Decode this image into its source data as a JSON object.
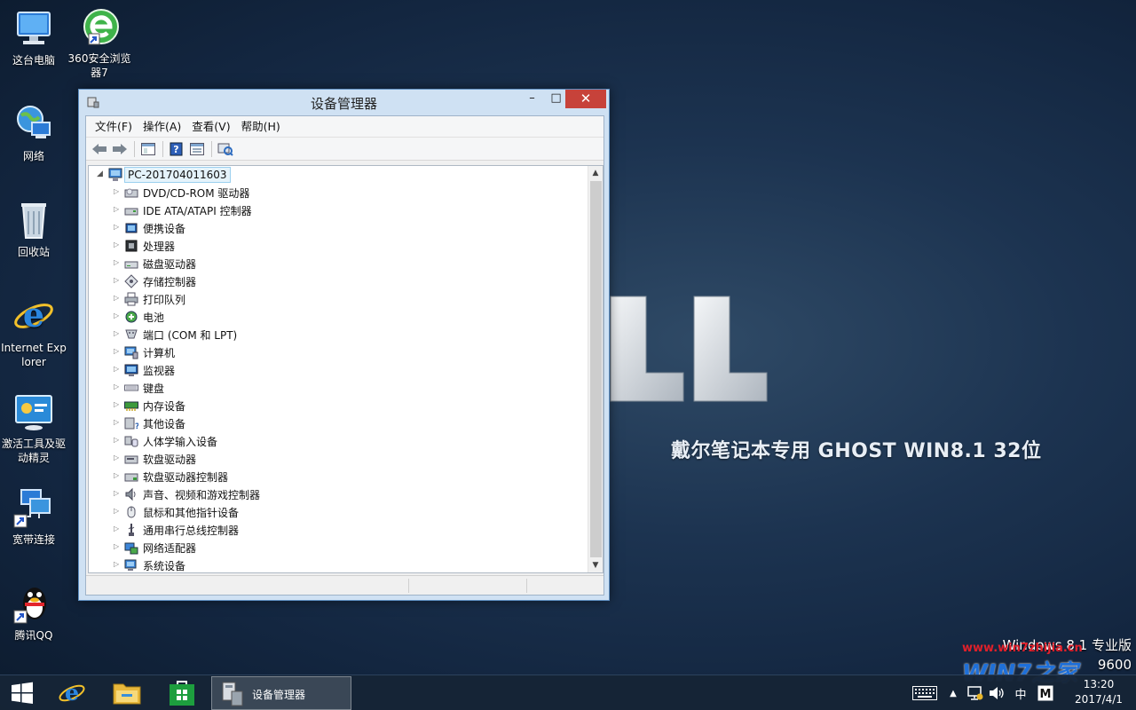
{
  "desktop": {
    "icons": [
      {
        "label": "这台电脑"
      },
      {
        "label": "360安全浏览器7"
      },
      {
        "label": "网络"
      },
      {
        "label": "回收站"
      },
      {
        "label": "Internet Explorer"
      },
      {
        "label": "激活工具及驱动精灵"
      },
      {
        "label": "宽带连接"
      },
      {
        "label": "腾讯QQ"
      }
    ],
    "wallpaper_text": "戴尔笔记本专用  GHOST WIN8.1 32位",
    "version_line1": "Windows 8.1 专业版",
    "version_line2": "9600",
    "watermark_url": "www.win7zhijia.cn",
    "watermark_logo": "WIN7之家"
  },
  "window": {
    "title": "设备管理器",
    "menu": [
      "文件(F)",
      "操作(A)",
      "查看(V)",
      "帮助(H)"
    ],
    "root": "PC-201704011603",
    "devices": [
      {
        "label": "DVD/CD-ROM 驱动器",
        "icon": "dvd-drive-icon"
      },
      {
        "label": "IDE ATA/ATAPI 控制器",
        "icon": "ide-controller-icon"
      },
      {
        "label": "便携设备",
        "icon": "portable-device-icon"
      },
      {
        "label": "处理器",
        "icon": "processor-icon"
      },
      {
        "label": "磁盘驱动器",
        "icon": "disk-drive-icon"
      },
      {
        "label": "存储控制器",
        "icon": "storage-controller-icon"
      },
      {
        "label": "打印队列",
        "icon": "printer-icon"
      },
      {
        "label": "电池",
        "icon": "battery-icon"
      },
      {
        "label": "端口 (COM 和 LPT)",
        "icon": "port-icon"
      },
      {
        "label": "计算机",
        "icon": "computer-icon"
      },
      {
        "label": "监视器",
        "icon": "monitor-icon"
      },
      {
        "label": "键盘",
        "icon": "keyboard-icon"
      },
      {
        "label": "内存设备",
        "icon": "memory-icon"
      },
      {
        "label": "其他设备",
        "icon": "other-device-icon"
      },
      {
        "label": "人体学输入设备",
        "icon": "hid-icon"
      },
      {
        "label": "软盘驱动器",
        "icon": "floppy-drive-icon"
      },
      {
        "label": "软盘驱动器控制器",
        "icon": "floppy-controller-icon"
      },
      {
        "label": "声音、视频和游戏控制器",
        "icon": "sound-icon"
      },
      {
        "label": "鼠标和其他指针设备",
        "icon": "mouse-icon"
      },
      {
        "label": "通用串行总线控制器",
        "icon": "usb-icon"
      },
      {
        "label": "网络适配器",
        "icon": "network-adapter-icon"
      },
      {
        "label": "系统设备",
        "icon": "system-device-icon"
      }
    ]
  },
  "taskbar": {
    "task_label": "设备管理器",
    "ime_label": "中",
    "clock_time": "13:20",
    "clock_date": "2017/4/1"
  }
}
